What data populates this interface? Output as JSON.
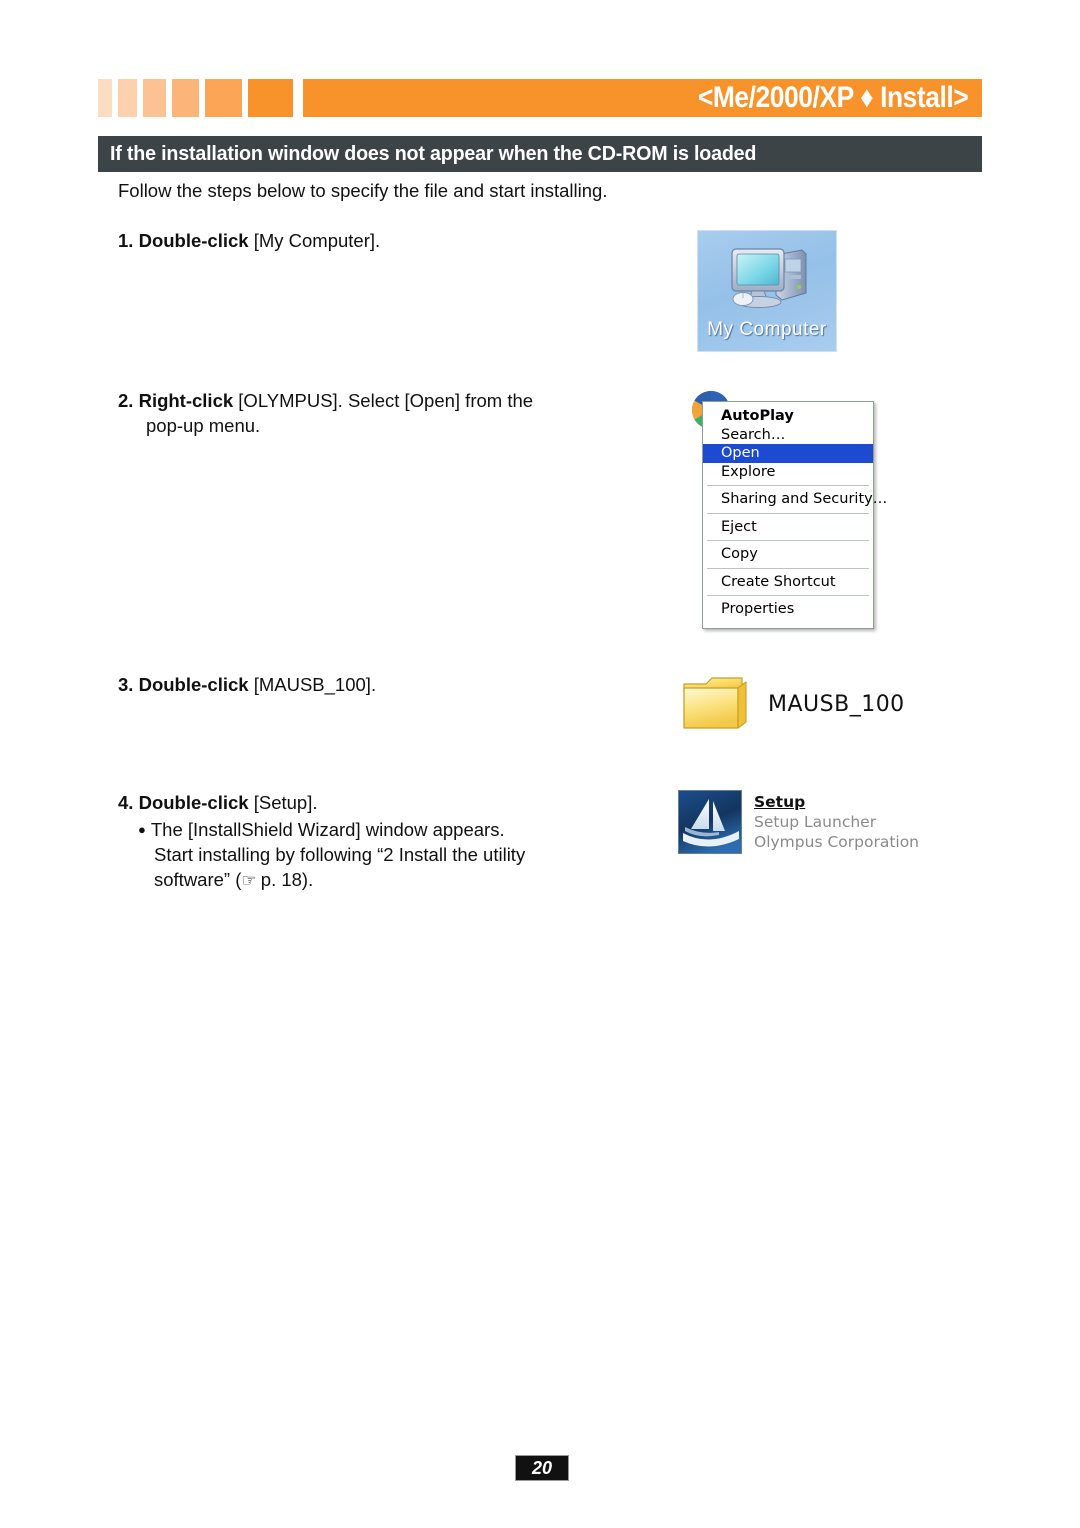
{
  "header": {
    "title": "<Me/2000/XP ♦ Install>",
    "accent_color": "#f8922a",
    "segment_colors": [
      "#fcddc2",
      "#fdd0ae",
      "#fdc294",
      "#fdb478",
      "#fda557",
      "#f8922a"
    ]
  },
  "section": {
    "title": "If the installation window does not appear when the CD-ROM is loaded",
    "bar_color": "#3d4448"
  },
  "body": {
    "intro": "Follow the steps below to specify the file and start installing."
  },
  "steps": [
    {
      "number": "1.",
      "action": "Double-click",
      "target": " [My Computer]."
    },
    {
      "number": "2.",
      "action": "Right-click",
      "target": " [OLYMPUS]. Select [Open] from the",
      "continuation": "pop-up menu."
    },
    {
      "number": "3.",
      "action": "Double-click",
      "target": " [MAUSB_100]."
    },
    {
      "number": "4.",
      "action": "Double-click",
      "target": " [Setup].",
      "bullet_glyph": "●",
      "bullet_line1": "The [InstallShield Wizard] window appears.",
      "bullet_line2": "Start installing by following “2  Install the utility",
      "bullet_line3_pre": "software” (",
      "bullet_hand": "☞",
      "bullet_line3_post": " p. 18)."
    }
  ],
  "figures": {
    "my_computer": {
      "label": "My Computer",
      "desktop_color": "#95c0e8"
    },
    "context_menu": {
      "items": [
        {
          "label": "AutoPlay",
          "bold": true,
          "selected": false,
          "separator_after": false
        },
        {
          "label": "Search…",
          "bold": false,
          "selected": false,
          "separator_after": false
        },
        {
          "label": "Open",
          "bold": false,
          "selected": true,
          "separator_after": false
        },
        {
          "label": "Explore",
          "bold": false,
          "selected": false,
          "separator_after": true
        },
        {
          "label": "Sharing and Security…",
          "bold": false,
          "selected": false,
          "separator_after": true
        },
        {
          "label": "Eject",
          "bold": false,
          "selected": false,
          "separator_after": true
        },
        {
          "label": "Copy",
          "bold": false,
          "selected": false,
          "separator_after": true
        },
        {
          "label": "Create Shortcut",
          "bold": false,
          "selected": false,
          "separator_after": true
        },
        {
          "label": "Properties",
          "bold": false,
          "selected": false,
          "separator_after": false
        }
      ],
      "highlight_color": "#1c4ad0"
    },
    "folder": {
      "label": "MAUSB_100"
    },
    "setup": {
      "name": "Setup",
      "description": "Setup Launcher",
      "company": "Olympus Corporation"
    }
  },
  "footer": {
    "page_number": "20"
  }
}
